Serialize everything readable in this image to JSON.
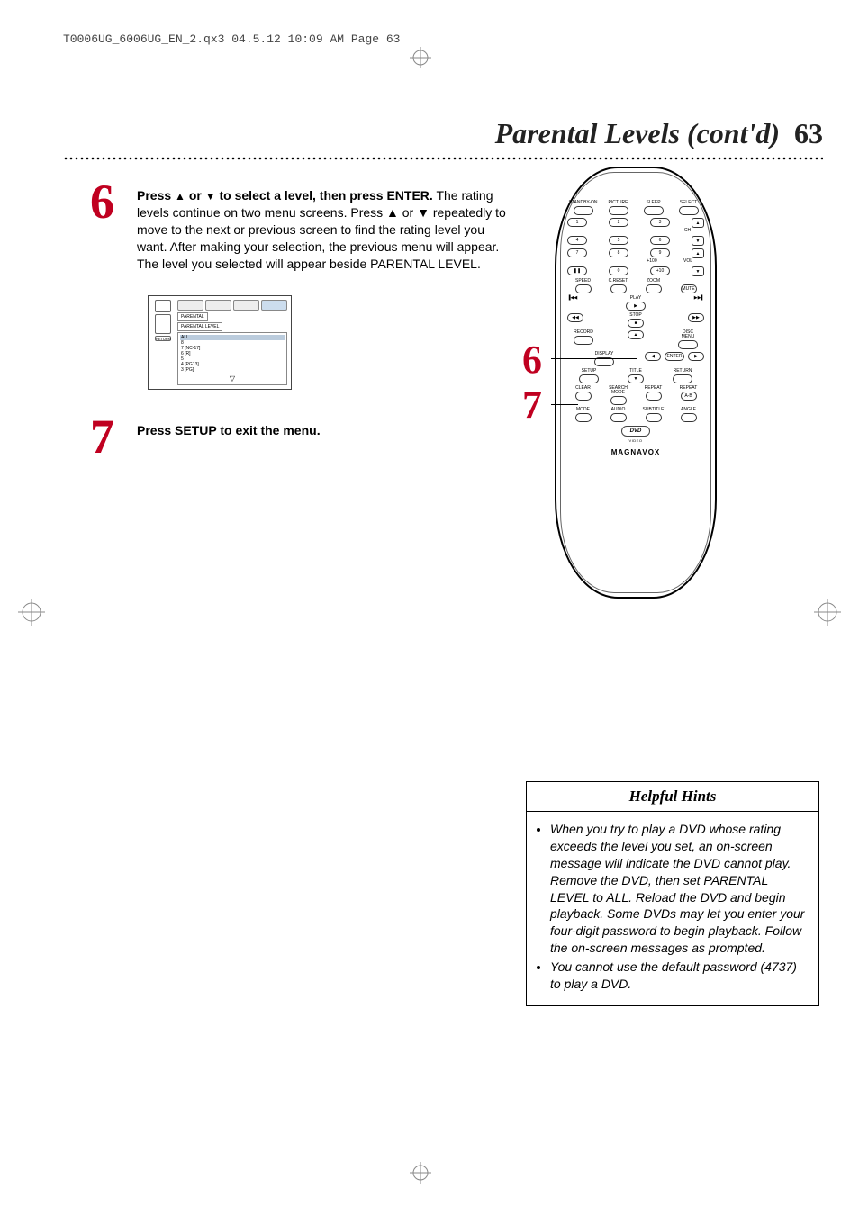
{
  "print_header": "T0006UG_6006UG_EN_2.qx3  04.5.12  10:09 AM  Page 63",
  "page": {
    "title": "Parental Levels (cont'd)",
    "number": "63"
  },
  "steps": {
    "six": {
      "num": "6",
      "lead_a": "Press ",
      "lead_b": " or ",
      "lead_c": " to select a level, then press ENTER.",
      "body": "  The rating levels continue on two menu screens.  Press ▲ or ▼ repeatedly to move to the next or previous screen to find the rating level you want.  After making your selection, the previous menu will appear.  The level you selected will appear beside PARENTAL LEVEL."
    },
    "seven": {
      "num": "7",
      "body": "Press SETUP to exit the menu."
    }
  },
  "osd": {
    "crumb1": "PARENTAL",
    "crumb2": "PARENTAL LEVEL",
    "items": [
      "ALL",
      "8",
      "7 [NC-17]",
      "6 [R]",
      "5",
      "4 [PG13]",
      "3 [PG]"
    ],
    "return_btn": "RETURN",
    "down": "▽"
  },
  "remote": {
    "row1": [
      "STANDBY-ON",
      "PICTURE",
      "SLEEP",
      "SELECT"
    ],
    "numpad": [
      [
        "1",
        "2",
        "3"
      ],
      [
        "4",
        "5",
        "6"
      ],
      [
        "7",
        "8",
        "9"
      ]
    ],
    "ch": "CH",
    "vol": "VOL",
    "plus100": "+100",
    "pause": "❚❚",
    "zero": "0",
    "plus10": "+10",
    "row_under_num": [
      "SPEED",
      "C.RESET",
      "ZOOM"
    ],
    "mute": "MUTE",
    "transport": {
      "prev": "▐◀◀",
      "rew": "◀◀",
      "play_lbl": "PLAY",
      "play": "▶",
      "ff": "▶▶",
      "next": "▶▶▌",
      "stop_lbl": "STOP",
      "stop": "■"
    },
    "record": "RECORD",
    "disc_menu": "DISC\nMENU",
    "nav": {
      "up": "▲",
      "down": "▼",
      "left": "◀",
      "right": "▶",
      "enter": "ENTER"
    },
    "display": "DISPLAY",
    "setup": "SETUP",
    "title": "TITLE",
    "return": "RETURN",
    "row_bottom1": [
      "CLEAR",
      "SEARCH MODE",
      "REPEAT",
      "REPEAT"
    ],
    "ab": "A-B",
    "row_bottom2": [
      "MODE",
      "AUDIO",
      "SUBTITLE",
      "ANGLE"
    ],
    "dvd": "DVD",
    "dvd_sub": "VIDEO",
    "brand": "MAGNAVOX"
  },
  "callouts": {
    "six": "6",
    "seven": "7"
  },
  "hints": {
    "title": "Helpful Hints",
    "items": [
      "When you try to play a DVD whose rating exceeds the level you set, an on-screen message will indicate the DVD cannot play.  Remove the DVD, then set PARENTAL LEVEL to ALL.  Reload the DVD and begin playback.  Some DVDs may let you enter your four-digit password to begin playback.  Follow the on-screen messages as prompted.",
      "You cannot use the default password (4737) to play a DVD."
    ]
  }
}
